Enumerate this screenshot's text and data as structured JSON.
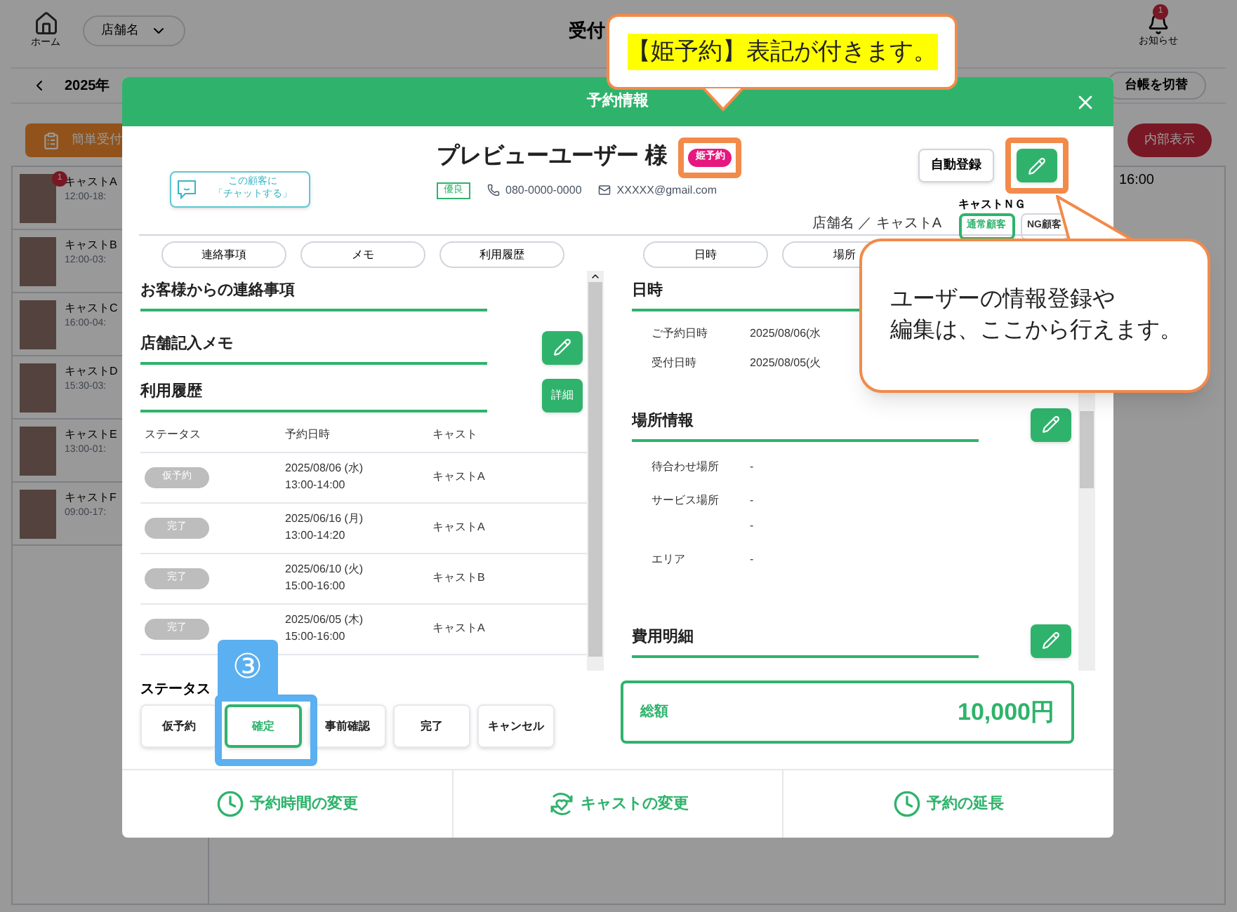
{
  "app": {
    "home_label": "ホーム",
    "store_select": "店舗名",
    "title": "受付",
    "notification": {
      "badge": "1",
      "label": "お知らせ"
    },
    "date": "2025年",
    "ledger_button": "台帳を切替",
    "quick_button": "簡単受付",
    "internal_button": "内部表示",
    "time_label": "16:00",
    "casts": [
      {
        "name": "キャストA",
        "time": "12:00-18:",
        "badge": "1"
      },
      {
        "name": "キャストB",
        "time": "12:00-03:"
      },
      {
        "name": "キャストC",
        "time": "16:00-04:"
      },
      {
        "name": "キャストD",
        "time": "15:30-03:"
      },
      {
        "name": "キャストE",
        "time": "13:00-01:"
      },
      {
        "name": "キャストF",
        "time": "09:00-17:"
      }
    ]
  },
  "modal": {
    "title": "予約情報",
    "chat_button": [
      "この顧客に",
      "「チャットする」"
    ],
    "customer": {
      "name": "プレビューユーザー 様",
      "badge": "姫予約",
      "rank": "優良",
      "phone": "080-0000-0000",
      "email": "XXXXX@gmail.com",
      "shop_cast": "店舗名 ／ キャストA"
    },
    "auto_register_button": "自動登録",
    "cast_ng": {
      "label": "キャストＮＧ",
      "options": [
        {
          "label": "通常顧客",
          "selected": true
        },
        {
          "label": "NG顧客",
          "selected": false
        }
      ]
    },
    "left_tabs": [
      "連絡事項",
      "メモ",
      "利用履歴"
    ],
    "right_tabs": [
      "日時",
      "場所"
    ],
    "sections": {
      "contact": "お客様からの連絡事項",
      "memo": "店舗記入メモ",
      "history": "利用履歴",
      "detail_button": "詳細"
    },
    "history": {
      "columns": [
        "ステータス",
        "予約日時",
        "キャスト"
      ],
      "rows": [
        {
          "status": "仮予約",
          "date": "2025/08/06 (水)",
          "time": "13:00-14:00",
          "cast": "キャストA"
        },
        {
          "status": "完了",
          "date": "2025/06/16 (月)",
          "time": "13:00-14:20",
          "cast": "キャストA"
        },
        {
          "status": "完了",
          "date": "2025/06/10 (火)",
          "time": "15:00-16:00",
          "cast": "キャストB"
        },
        {
          "status": "完了",
          "date": "2025/06/05 (木)",
          "time": "15:00-16:00",
          "cast": "キャストA"
        }
      ]
    },
    "status": {
      "label": "ステータス",
      "options": [
        {
          "label": "仮予約",
          "selected": false
        },
        {
          "label": "確定",
          "selected": true
        },
        {
          "label": "事前確認",
          "selected": false
        },
        {
          "label": "完了",
          "selected": false
        },
        {
          "label": "キャンセル",
          "selected": false
        }
      ]
    },
    "datetime": {
      "title": "日時",
      "rows": [
        {
          "label": "ご予約日時",
          "value": "2025/08/06(水"
        },
        {
          "label": "受付日時",
          "value": "2025/08/05(火"
        }
      ]
    },
    "place": {
      "title": "場所情報",
      "rows": [
        {
          "label": "待合わせ場所",
          "values": [
            "-"
          ]
        },
        {
          "label": "サービス場所",
          "values": [
            "-",
            "-"
          ]
        },
        {
          "label": "エリア",
          "values": [
            "-"
          ]
        }
      ]
    },
    "cost": {
      "title": "費用明細"
    },
    "total": {
      "label": "総額",
      "value": "10,000円"
    },
    "footer": [
      "予約時間の変更",
      "キャストの変更",
      "予約の延長"
    ]
  },
  "annotations": {
    "badge_callout": "【姫予約】表記が付きます。",
    "edit_callout": [
      "ユーザーの情報登録や",
      "編集は、ここから行えます。"
    ],
    "step": "③"
  }
}
